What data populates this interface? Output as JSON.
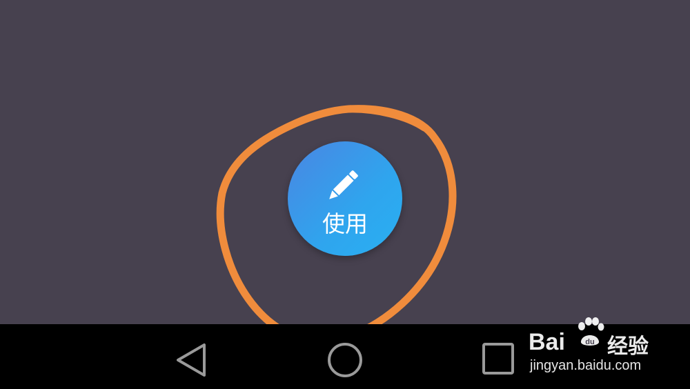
{
  "screen": {
    "background": "#47414f",
    "navbar_color": "#000000"
  },
  "action_button": {
    "label": "使用",
    "icon": "pencil-icon",
    "gradient_start": "#4a86e2",
    "gradient_end": "#29b0f2"
  },
  "annotation": {
    "shape": "hand-drawn circle",
    "color": "#f08c3c"
  },
  "nav_bar": {
    "buttons": [
      {
        "name": "back",
        "icon": "triangle-back-icon"
      },
      {
        "name": "home",
        "icon": "circle-home-icon"
      },
      {
        "name": "recents",
        "icon": "square-recents-icon"
      }
    ],
    "icon_color": "#9a9a9a"
  },
  "watermark": {
    "brand": "Bai",
    "brand_suffix": "du",
    "cn": "经验",
    "url": "jingyan.baidu.com"
  }
}
